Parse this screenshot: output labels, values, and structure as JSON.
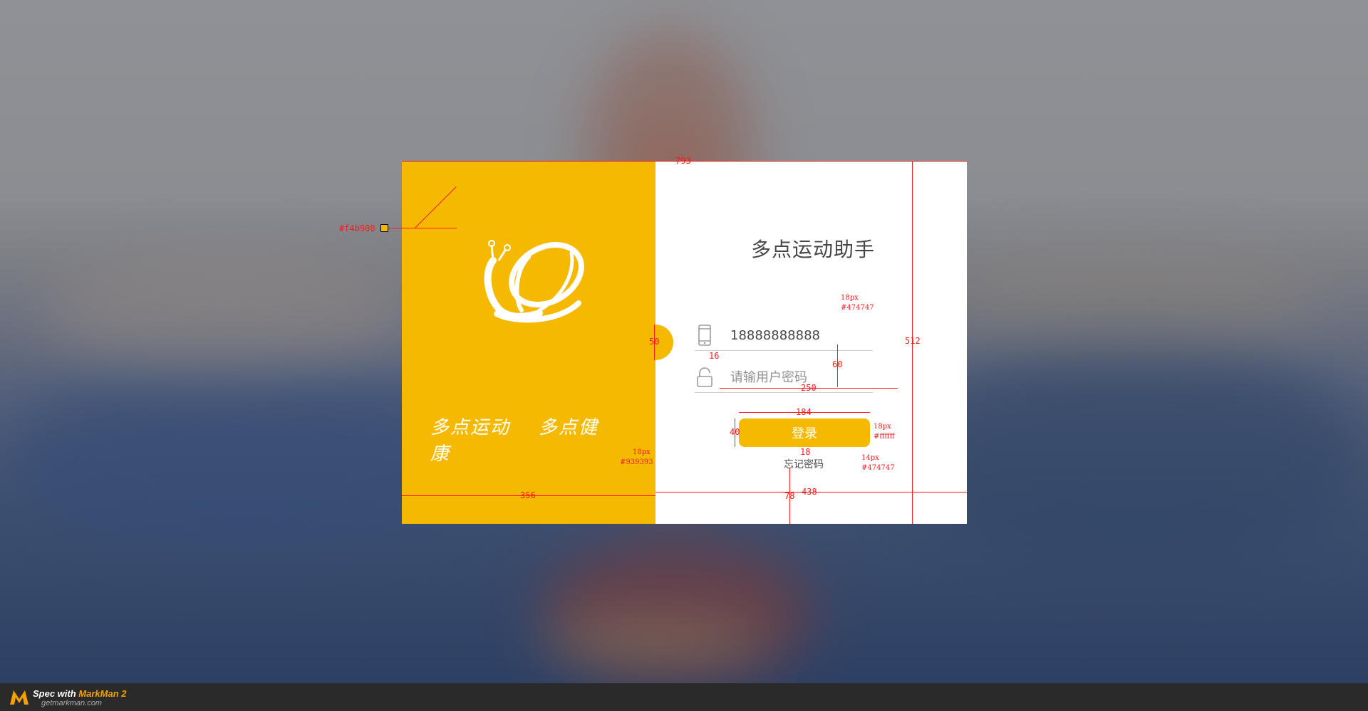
{
  "app": {
    "title": "多点运动助手",
    "slogan": [
      "多点运动",
      "多点健康"
    ]
  },
  "form": {
    "phone_value": "18888888888",
    "password_placeholder": "请输用户密码",
    "login_label": "登录",
    "forgot_label": "忘记密码"
  },
  "annotations": {
    "color_brand": "#f4b900",
    "width_total": "793",
    "width_left": "356",
    "width_right": "438",
    "height_total": "512",
    "circle_height": "50",
    "input_icon_gap": "16",
    "field_spacing": "60",
    "field_width": "250",
    "button_width": "184",
    "button_height": "40",
    "button_gap": "18",
    "bottom_gap": "78",
    "phone_font_size": "18px",
    "phone_font_color": "#474747",
    "placeholder_font_size": "18px",
    "placeholder_font_color": "#939393",
    "button_font_size": "18px",
    "button_font_color": "#ffffff",
    "forgot_font_size": "14px",
    "forgot_font_color": "#474747"
  },
  "footer": {
    "spec_prefix": "Spec with ",
    "brand": "MarkMan 2",
    "site": "getmarkman.com"
  },
  "colors": {
    "brand_yellow": "#f4b900",
    "text_dark": "#474747",
    "text_placeholder": "#939393",
    "annotation_red": "#ff1a1a"
  }
}
